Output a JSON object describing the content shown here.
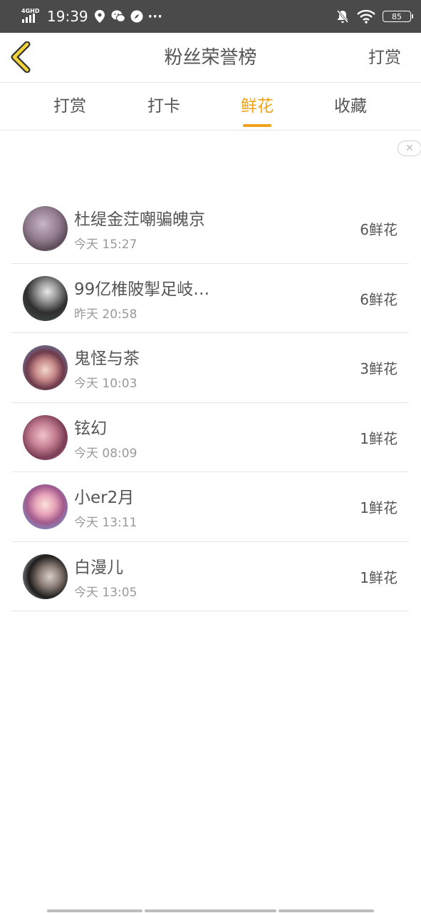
{
  "status_bar": {
    "network": "4GHD",
    "time": "19:39",
    "icons": [
      "location-icon",
      "wechat-icon",
      "compass-icon",
      "more-dots-icon"
    ],
    "more": "···",
    "battery": "85"
  },
  "header": {
    "title": "粉丝荣誉榜",
    "action": "打赏"
  },
  "tabs": [
    {
      "label": "打赏",
      "active": false
    },
    {
      "label": "打卡",
      "active": false
    },
    {
      "label": "鲜花",
      "active": true
    },
    {
      "label": "收藏",
      "active": false
    }
  ],
  "close_ad": "✕",
  "rows": [
    {
      "name": "杜缇金茳嘲骗魄京",
      "time": "今天 15:27",
      "count": "6鲜花"
    },
    {
      "name": "99亿椎陂掣足岐…",
      "time": "昨天 20:58",
      "count": "6鲜花"
    },
    {
      "name": "鬼怪与茶",
      "time": "今天 10:03",
      "count": "3鲜花"
    },
    {
      "name": "铉幻",
      "time": "今天 08:09",
      "count": "1鲜花"
    },
    {
      "name": "小er2月",
      "time": "今天 13:11",
      "count": "1鲜花"
    },
    {
      "name": "白漫儿",
      "time": "今天 13:05",
      "count": "1鲜花"
    }
  ],
  "colors": {
    "accent": "#f0a31a",
    "status_bar": "#4a4a4a",
    "text": "#555555",
    "subtext": "#999999"
  }
}
